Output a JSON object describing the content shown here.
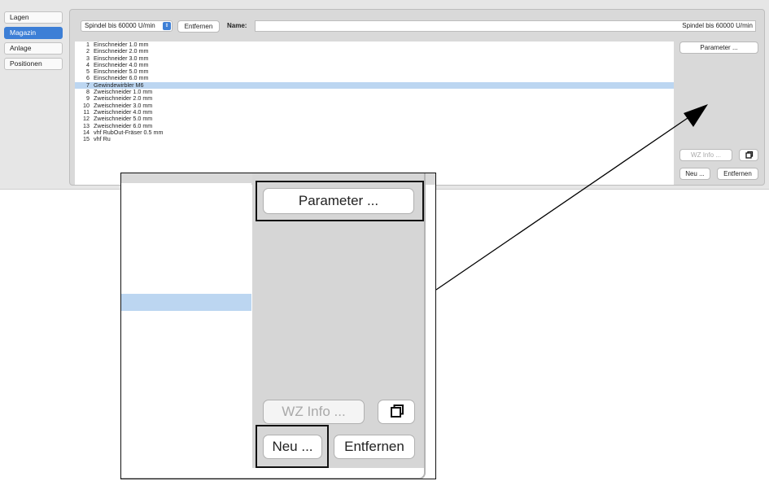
{
  "nav": {
    "items": [
      {
        "label": "Lagen",
        "active": false
      },
      {
        "label": "Magazin",
        "active": true
      },
      {
        "label": "Anlage",
        "active": false
      },
      {
        "label": "Positionen",
        "active": false
      }
    ]
  },
  "toolbar": {
    "spindle_select": "Spindel bis 60000 U/min",
    "remove_label": "Entfernen",
    "name_label": "Name:",
    "name_value": "Spindel bis 60000 U/min"
  },
  "tools": [
    {
      "num": "1",
      "name": "Einschneider 1.0 mm"
    },
    {
      "num": "2",
      "name": "Einschneider 2.0 mm"
    },
    {
      "num": "3",
      "name": "Einschneider 3.0 mm"
    },
    {
      "num": "4",
      "name": "Einschneider 4.0 mm"
    },
    {
      "num": "5",
      "name": "Einschneider 5.0 mm"
    },
    {
      "num": "6",
      "name": "Einschneider 6.0 mm"
    },
    {
      "num": "7",
      "name": "Gewindewirbler M6",
      "selected": true
    },
    {
      "num": "8",
      "name": "Zweischneider 1.0 mm"
    },
    {
      "num": "9",
      "name": "Zweischneider 2.0 mm"
    },
    {
      "num": "10",
      "name": "Zweischneider 3.0 mm"
    },
    {
      "num": "11",
      "name": "Zweischneider 4.0 mm"
    },
    {
      "num": "12",
      "name": "Zweischneider 5.0 mm"
    },
    {
      "num": "13",
      "name": "Zweischneider 6.0 mm"
    },
    {
      "num": "14",
      "name": "vhf RubOut-Fräser 0.5 mm"
    },
    {
      "num": "15",
      "name": "vhf Ru"
    }
  ],
  "side": {
    "parameter_label": "Parameter ...",
    "wz_info_label": "WZ Info ...",
    "new_label": "Neu ...",
    "remove_label": "Entfernen",
    "copy_icon": "copy-icon"
  },
  "colors": {
    "accent": "#3d7fd6",
    "selection": "#bcd6f1"
  }
}
